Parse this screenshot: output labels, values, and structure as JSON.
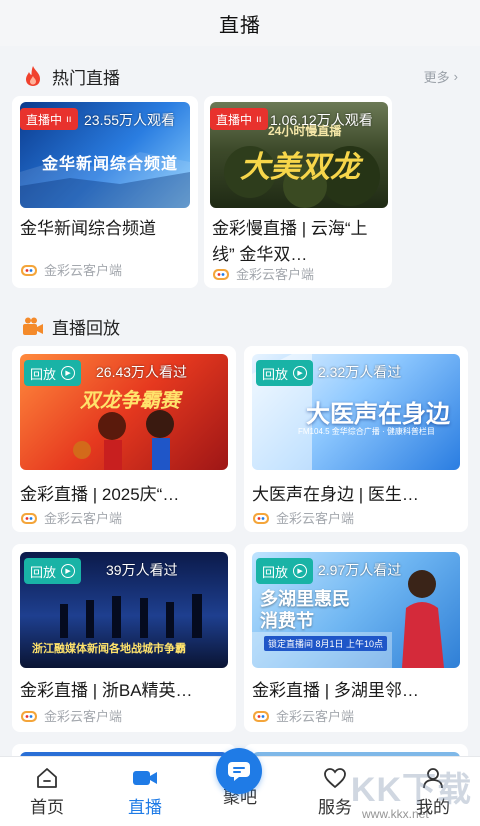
{
  "header": {
    "title": "直播"
  },
  "hot": {
    "title": "热门直播",
    "more": "更多",
    "items": [
      {
        "badge": "直播中",
        "viewers": "23.55万人观看",
        "thumb_text": "金华新闻综合频道",
        "title": "金华新闻综合频道",
        "source": "金彩云客户端"
      },
      {
        "badge": "直播中",
        "viewers": "1.06.12万人观看",
        "thumb_text": "大美双龙",
        "thumb_sub": "24小时慢直播",
        "title": "金彩慢直播 | 云海“上线” 金华双…",
        "source": "金彩云客户端"
      }
    ]
  },
  "replay": {
    "title": "直播回放",
    "items": [
      {
        "badge": "回放",
        "viewers": "26.43万人看过",
        "thumb_text": "双龙争霸赛",
        "title": "金彩直播 | 2025庆“…",
        "source": "金彩云客户端"
      },
      {
        "badge": "回放",
        "viewers": "2.32万人看过",
        "thumb_text": "大医声在身边",
        "thumb_sub": "FM104.5 金华综合广播 · 健康科普栏目",
        "title": "大医声在身边 | 医生…",
        "source": "金彩云客户端"
      },
      {
        "badge": "回放",
        "viewers": "39万人看过",
        "thumb_text": "浙江融媒体新闻各地战城市争霸",
        "title": "金彩直播 | 浙BA精英…",
        "source": "金彩云客户端"
      },
      {
        "badge": "回放",
        "viewers": "2.97万人看过",
        "thumb_text": "多湖里惠民消费节",
        "thumb_sub": "锁定直播间 8月1日 上午10点",
        "title": "金彩直播 | 多湖里邻…",
        "source": "金彩云客户端"
      }
    ]
  },
  "tabbar": {
    "tabs": [
      {
        "label": "首页",
        "icon": "home-icon"
      },
      {
        "label": "直播",
        "icon": "video-icon"
      },
      {
        "label": "聚吧",
        "icon": "chat-icon"
      },
      {
        "label": "服务",
        "icon": "heart-icon"
      },
      {
        "label": "我的",
        "icon": "user-icon"
      }
    ],
    "active": "直播"
  },
  "watermark": {
    "text": "KK下载",
    "url": "www.kkx.net"
  },
  "colors": {
    "accent": "#1f7be6",
    "live": "#e8322d",
    "replay": "#19b3a6"
  }
}
